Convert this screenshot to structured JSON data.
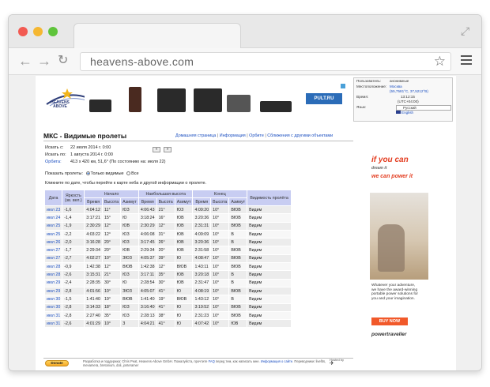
{
  "browser": {
    "url": "heavens-above.com"
  },
  "header": {
    "logo_text": "HEAVENS\nABOVE",
    "ad_brand": "PULT.RU"
  },
  "userbox": {
    "user_label": "Пользователь:",
    "user_value": "анонимные",
    "location_label": "Местоположение:",
    "location_value": "Москва",
    "coords": "(55,7581°С, 37,5212°В)",
    "time_label": "Время:",
    "time_value": "13:12:15",
    "tz": "(UTC+04:00)",
    "lang_label": "Язык:",
    "lang_select": "Русский",
    "lang_alt": "English"
  },
  "page": {
    "title": "МКС - Видимые пролеты",
    "nav": [
      "Домашняя страница",
      "Информация",
      "Орбите",
      "Сближения с другими объектами"
    ],
    "search_from_label": "Искать с:",
    "search_from": "22 июля 2014 г. 0:00",
    "search_to_label": "Искать по:",
    "search_to": "1 августа 2014 г. 0:00",
    "orbit_label": "Орбита:",
    "orbit_value": "413 x 420 км, 51,6° (По состоянию на: июля 22)",
    "prev_btn": "«",
    "next_btn": "»",
    "show_label": "Показать пролеты:",
    "show_opt1": "Только видимые",
    "show_opt2": "Все",
    "hint": "Кликните по дате, чтобы перейти к карте неба и другой информации о пролете."
  },
  "table": {
    "group_headers": [
      "Начало",
      "Наибольшая высота",
      "Конец"
    ],
    "col_date": "Дата",
    "col_mag": "Яркость (зв. вел.)",
    "col_vis": "Видимость пролёта",
    "sub_headers": [
      "Время",
      "Высота",
      "Азимут",
      "Время",
      "Высота",
      "Азимут",
      "Время",
      "Высота",
      "Азимут"
    ],
    "rows": [
      [
        "июл 23",
        "-1,6",
        "4:04:12",
        "11°",
        "ЮЗ",
        "4:06:43",
        "21°",
        "ЮЗ",
        "4:09:20",
        "10°",
        "ВЮВ",
        "Видим"
      ],
      [
        "июл 24",
        "-1,4",
        "3:17:21",
        "15°",
        "Ю",
        "3:18:24",
        "16°",
        "ЮВ",
        "3:20:36",
        "10°",
        "ВЮВ",
        "Видим"
      ],
      [
        "июл 25",
        "-1,9",
        "2:30:29",
        "12°",
        "ЮВ",
        "2:30:29",
        "12°",
        "ЮВ",
        "2:31:31",
        "10°",
        "ВЮВ",
        "Видим"
      ],
      [
        "июл 25",
        "-2,2",
        "4:03:22",
        "12°",
        "ЮЗ",
        "4:06:08",
        "31°",
        "ЮВ",
        "4:09:09",
        "10°",
        "В",
        "Видим"
      ],
      [
        "июл 26",
        "-2,0",
        "3:16:28",
        "20°",
        "ЮЗ",
        "3:17:45",
        "26°",
        "ЮВ",
        "3:20:36",
        "10°",
        "В",
        "Видим"
      ],
      [
        "июл 27",
        "-1,7",
        "2:29:34",
        "20°",
        "ЮВ",
        "2:29:34",
        "20°",
        "ЮВ",
        "2:31:58",
        "10°",
        "ВЮВ",
        "Видим"
      ],
      [
        "июл 27",
        "-2,7",
        "4:02:27",
        "10°",
        "ЗЮЗ",
        "4:05:37",
        "39°",
        "Ю",
        "4:08:47",
        "10°",
        "ВЮВ",
        "Видим"
      ],
      [
        "июл 28",
        "-0,9",
        "1:42:38",
        "12°",
        "ВЮВ",
        "1:42:38",
        "12°",
        "ВЮВ",
        "1:43:11",
        "10°",
        "ВЮВ",
        "Видим"
      ],
      [
        "июл 28",
        "-2,6",
        "3:15:31",
        "21°",
        "ЮЗ",
        "3:17:11",
        "35°",
        "ЮВ",
        "3:20:18",
        "10°",
        "В",
        "Видим"
      ],
      [
        "июл 29",
        "-2,4",
        "2:28:35",
        "30°",
        "Ю",
        "2:28:54",
        "30°",
        "ЮВ",
        "2:31:47",
        "10°",
        "В",
        "Видим"
      ],
      [
        "июл 29",
        "-2,8",
        "4:01:56",
        "10°",
        "ЗЮЗ",
        "4:05:07",
        "41°",
        "Ю",
        "4:08:19",
        "10°",
        "ВЮВ",
        "Видим"
      ],
      [
        "июл 30",
        "-1,5",
        "1:41:40",
        "19°",
        "ВЮВ",
        "1:41:40",
        "19°",
        "ВЮВ",
        "1:43:12",
        "10°",
        "В",
        "Видим"
      ],
      [
        "июл 30",
        "-2,8",
        "3:14:33",
        "18°",
        "ЮЗ",
        "3:16:40",
        "41°",
        "Ю",
        "3:19:52",
        "10°",
        "ВЮВ",
        "Видим"
      ],
      [
        "июл 31",
        "-2,8",
        "2:27:40",
        "35°",
        "ЮЗ",
        "2:28:13",
        "38°",
        "Ю",
        "2:31:23",
        "10°",
        "ВЮВ",
        "Видим"
      ],
      [
        "июл 31",
        "-2,6",
        "4:01:29",
        "10°",
        "З",
        "4:04:21",
        "41°",
        "Ю",
        "4:07:42",
        "10°",
        "ЮВ",
        "Видим"
      ]
    ]
  },
  "right_ad": {
    "headline_1": "if you can",
    "headline_2": "dream it",
    "headline_3": "we can power it",
    "copy": "Whatever your adventure, we have the award-winning portable power solutions for you and your imagination.",
    "button": "BUY NOW",
    "brand": "powertraveller"
  },
  "footer": {
    "donate": "Donate",
    "text_1": "Разработка и поддержка: Chris Peat, Heavens-Above GmbH. Пожалуйста, прочтите",
    "faq_link": "FAQ",
    "text_2": "перед тем, как написать мне.",
    "info_link": "Информация о сайте",
    "text_3": ". Переводчики: livefits, mevamera, bretonium, doli, jonteramer",
    "hosted": "Hosted by"
  }
}
